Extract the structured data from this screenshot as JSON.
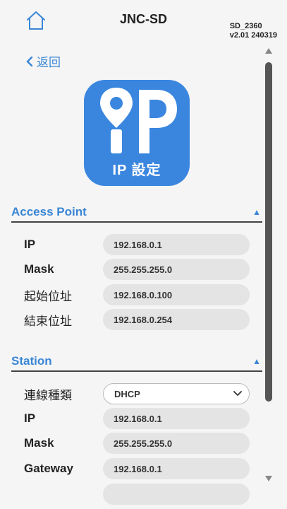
{
  "header": {
    "title": "JNC-SD",
    "device_id": "SD_2360",
    "version": "v2.01 240319",
    "home_icon": "home-icon"
  },
  "nav": {
    "back_label": "返回",
    "back_icon": "chevron-left-icon"
  },
  "logo": {
    "caption": "IP 設定",
    "icon": "ip-location-pin-icon",
    "color": "#3a86df"
  },
  "access_point": {
    "title": "Access Point",
    "collapse_icon": "▲",
    "fields": [
      {
        "label": "IP",
        "value": "192.168.0.1"
      },
      {
        "label": "Mask",
        "value": "255.255.255.0"
      },
      {
        "label": "起始位址",
        "value": "192.168.0.100"
      },
      {
        "label": "結束位址",
        "value": "192.168.0.254"
      }
    ]
  },
  "station": {
    "title": "Station",
    "collapse_icon": "▲",
    "connection_type_label": "連線種類",
    "connection_type_value": "DHCP",
    "fields": [
      {
        "label": "IP",
        "value": "192.168.0.1"
      },
      {
        "label": "Mask",
        "value": "255.255.255.0"
      },
      {
        "label": "Gateway",
        "value": "192.168.0.1"
      }
    ]
  },
  "theme": {
    "accent": "#3a86d6",
    "field_bg": "#e4e4e4",
    "background": "#f5f5f5"
  }
}
